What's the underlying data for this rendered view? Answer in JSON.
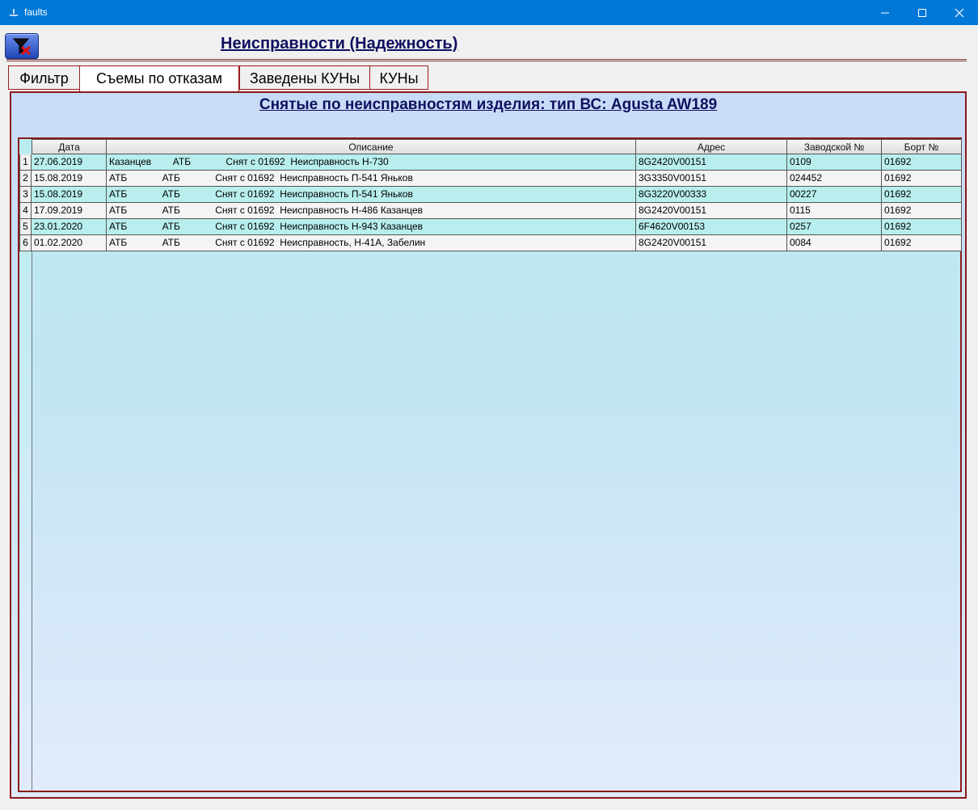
{
  "window": {
    "title": "faults"
  },
  "header": {
    "title": "Неисправности (Надежность)"
  },
  "tabs": [
    {
      "label": "Фильтр"
    },
    {
      "label": "Съемы по отказам",
      "active": true
    },
    {
      "label": "Заведены КУНы"
    },
    {
      "label": "КУНы"
    }
  ],
  "panel": {
    "title": "Снятые по неисправностям изделия:  тип ВС: Agusta AW189"
  },
  "table": {
    "columns": [
      "Дата",
      "Описание",
      "Адрес",
      "Заводской №",
      "Борт №"
    ],
    "rows": [
      {
        "n": "1",
        "date": "27.06.2019",
        "desc": "Казанцев        АТБ             Снят с 01692  Неисправность Н-730",
        "addr": "8G2420V00151",
        "serial": "0109",
        "board": "01692"
      },
      {
        "n": "2",
        "date": "15.08.2019",
        "desc": "АТБ             АТБ             Снят с 01692  Неисправность П-541 Яньков",
        "addr": "3G3350V00151",
        "serial": "024452",
        "board": "01692"
      },
      {
        "n": "3",
        "date": "15.08.2019",
        "desc": "АТБ             АТБ             Снят с 01692  Неисправность П-541 Яньков",
        "addr": "8G3220V00333",
        "serial": "00227",
        "board": "01692"
      },
      {
        "n": "4",
        "date": "17.09.2019",
        "desc": "АТБ             АТБ             Снят с 01692  Неисправность Н-486 Казанцев",
        "addr": "8G2420V00151",
        "serial": "0115",
        "board": "01692"
      },
      {
        "n": "5",
        "date": "23.01.2020",
        "desc": "АТБ             АТБ             Снят с 01692  Неисправность Н-943 Казанцев",
        "addr": "6F4620V00153",
        "serial": "0257",
        "board": "01692"
      },
      {
        "n": "6",
        "date": "01.02.2020",
        "desc": "АТБ             АТБ             Снят с 01692  Неисправность, Н-41А, Забелин",
        "addr": "8G2420V00151",
        "serial": "0084",
        "board": "01692"
      }
    ]
  }
}
